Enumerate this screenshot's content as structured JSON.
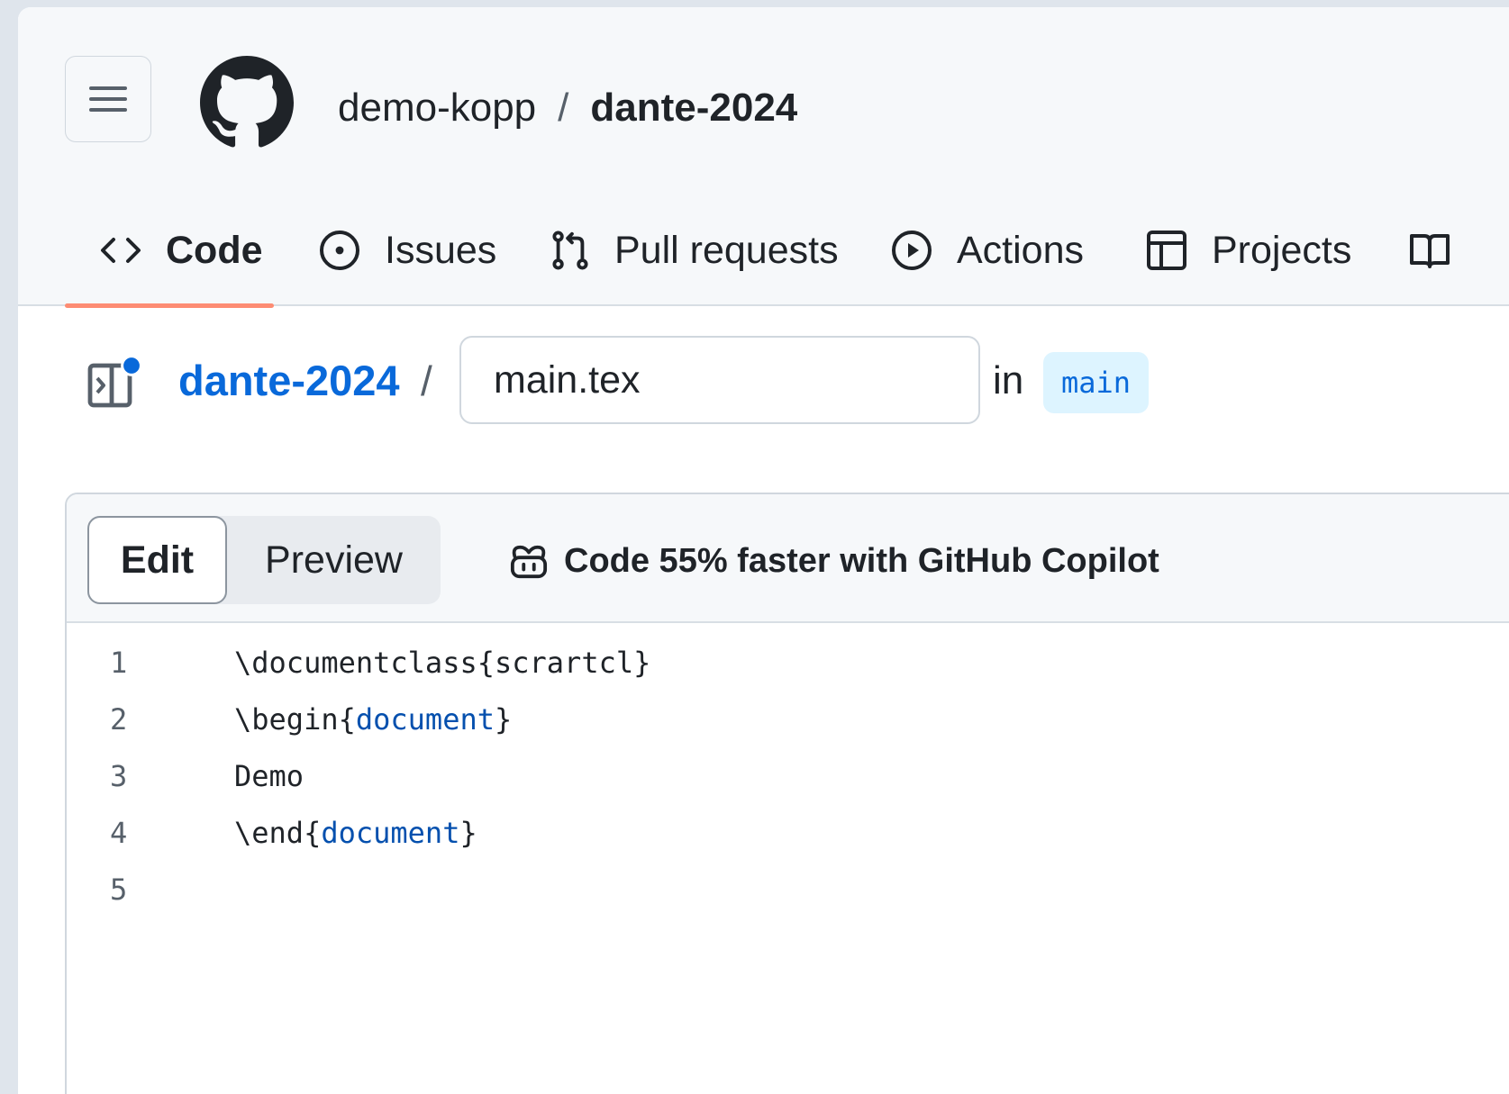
{
  "header": {
    "owner": "demo-kopp",
    "separator": "/",
    "repo": "dante-2024"
  },
  "tabs": [
    {
      "label": "Code",
      "icon": "code-icon",
      "selected": true
    },
    {
      "label": "Issues",
      "icon": "issue-opened-icon"
    },
    {
      "label": "Pull requests",
      "icon": "git-pull-request-icon"
    },
    {
      "label": "Actions",
      "icon": "play-icon"
    },
    {
      "label": "Projects",
      "icon": "table-icon"
    },
    {
      "label": "",
      "icon": "book-icon"
    }
  ],
  "breadcrumb": {
    "repo": "dante-2024",
    "separator": "/",
    "filename": "main.tex",
    "in_label": "in",
    "branch": "main"
  },
  "editor": {
    "edit_label": "Edit",
    "preview_label": "Preview",
    "copilot_text": "Code 55% faster with GitHub Copilot",
    "lines": [
      {
        "num": "1",
        "cmd": "\\documentclass",
        "open": "{",
        "arg": "scrartcl",
        "close": "}",
        "arg_highlight": false
      },
      {
        "num": "2",
        "cmd": "\\begin",
        "open": "{",
        "arg": "document",
        "close": "}",
        "arg_highlight": true
      },
      {
        "num": "3",
        "cmd": "Demo",
        "open": "",
        "arg": "",
        "close": "",
        "arg_highlight": false
      },
      {
        "num": "4",
        "cmd": "\\end",
        "open": "{",
        "arg": "document",
        "close": "}",
        "arg_highlight": true
      },
      {
        "num": "5",
        "cmd": "",
        "open": "",
        "arg": "",
        "close": "",
        "arg_highlight": false
      }
    ]
  },
  "colors": {
    "link": "#0969da",
    "tab_underline": "#fd8c73",
    "branch_bg": "#ddf4ff",
    "code_arg": "#0550ae"
  }
}
